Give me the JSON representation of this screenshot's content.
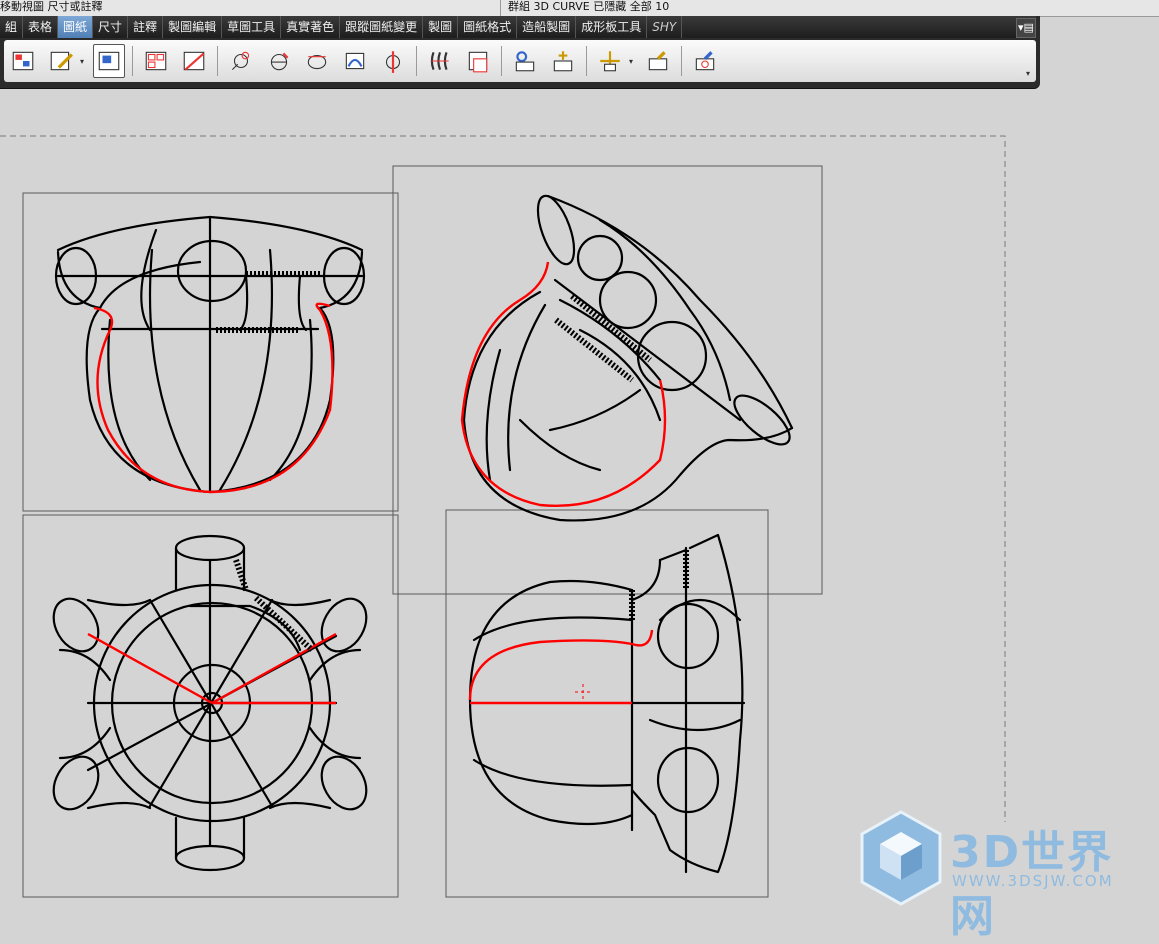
{
  "status_bar": {
    "left_text": "移動視圖  尺寸或註釋",
    "right_text": "群組  3D CURVE  已隱藏  全部 10"
  },
  "ribbon": {
    "tabs": [
      {
        "label": "組",
        "active": false
      },
      {
        "label": "表格",
        "active": false
      },
      {
        "label": "圖紙",
        "active": true
      },
      {
        "label": "尺寸",
        "active": false
      },
      {
        "label": "註釋",
        "active": false
      },
      {
        "label": "製圖編輯",
        "active": false
      },
      {
        "label": "草圖工具",
        "active": false
      },
      {
        "label": "真實著色",
        "active": false
      },
      {
        "label": "跟蹤圖紙變更",
        "active": false
      },
      {
        "label": "製圖",
        "active": false
      },
      {
        "label": "圖紙格式",
        "active": false
      },
      {
        "label": "造船製圖",
        "active": false
      },
      {
        "label": "成形板工具",
        "active": false
      },
      {
        "label": "SHY",
        "active": false
      }
    ],
    "toolbar_icons": [
      "drawing-sheet-icon",
      "edit-drawing-icon",
      "base-view-icon",
      "projected-view-icon",
      "section-view-icon",
      "detail-view-icon",
      "break-line-icon",
      "revolved-section-icon",
      "centerline-icon",
      "hatch-icon",
      "view-label-icon",
      "break-view-icon",
      "update-views-icon",
      "view-dependent-edit-icon",
      "move-view-icon",
      "camera-icon",
      "snapshot-icon"
    ]
  },
  "watermark": {
    "brand": "3D世界网",
    "url": "WWW.3DSJW.COM"
  },
  "colors": {
    "canvas": "#d4d4d4",
    "geometry": "#000000",
    "highlight": "#ff0000",
    "ribbon": "#2b2b2b",
    "active_tab": "#5b8ac2",
    "watermark": "#8fbbe0"
  }
}
